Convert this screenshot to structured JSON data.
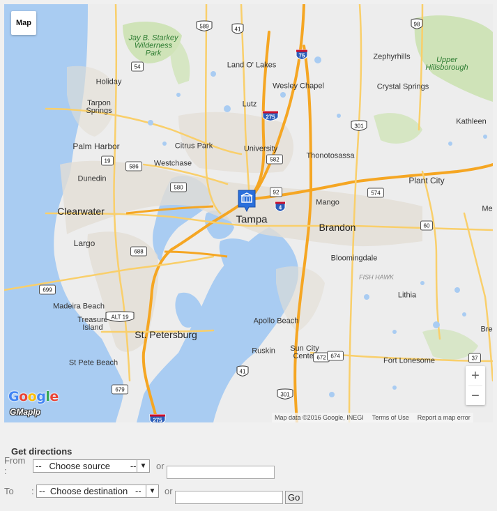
{
  "map": {
    "type_button": "Map",
    "zoom_in": "+",
    "zoom_out": "−",
    "attribution": "Map data ©2016 Google, INEGI",
    "terms": "Terms of Use",
    "report": "Report a map error",
    "logo": "Google",
    "watermark": "GMapIp",
    "colors": {
      "water": "#a9ccf2",
      "land": "#ededed",
      "urban": "#e2ddd4",
      "park": "#cfe3b8",
      "highway": "#f5a623",
      "major_road": "#f9cf6b"
    },
    "places": {
      "clearwater": "Clearwater",
      "tampa": "Tampa",
      "st_petersburg": "St. Petersburg",
      "brandon": "Brandon",
      "largo": "Largo",
      "palm_harbor": "Palm Harbor",
      "dunedin": "Dunedin",
      "holiday": "Holiday",
      "tarpon_springs": "Tarpon\nSprings",
      "land_o_lakes": "Land O' Lakes",
      "wesley_chapel": "Wesley Chapel",
      "lutz": "Lutz",
      "university": "University",
      "citrus_park": "Citrus Park",
      "westchase": "Westchase",
      "thonotosassa": "Thonotosassa",
      "mango": "Mango",
      "bloomingdale": "Bloomingdale",
      "lithia": "Lithia",
      "apollo_beach": "Apollo Beach",
      "ruskin": "Ruskin",
      "sun_city_center": "Sun City\nCenter",
      "fort_lonesome": "Fort Lonesome",
      "plant_city": "Plant City",
      "zephyrhills": "Zephyrhills",
      "crystal_springs": "Crystal Springs",
      "kathleen": "Kathleen",
      "madeira_beach": "Madeira Beach",
      "treasure_island": "Treasure\nIsland",
      "st_pete_beach": "St Pete Beach",
      "me": "Me",
      "bre": "Bre",
      "jay_b_starkey": "Jay B. Starkey\nWilderness\nPark",
      "upper_hillsborough": "Upper\nHillsborough",
      "fish_hawk": "FISH HAWK"
    },
    "route_numbers": [
      "589",
      "41",
      "98",
      "54",
      "75",
      "275",
      "301",
      "580",
      "586",
      "19",
      "582",
      "92",
      "4",
      "574",
      "60",
      "688",
      "699",
      "ALT 19",
      "672",
      "674",
      "41",
      "37",
      "679",
      "301",
      "275"
    ]
  },
  "directions": {
    "title": "Get directions",
    "from_label": "From :",
    "to_label": "To",
    "to_colon": ":",
    "source_selected": "--   Choose source        --",
    "destination_selected": "--  Choose destination   --",
    "or": "or",
    "go": "Go",
    "from_text_value": "",
    "to_text_value": ""
  }
}
